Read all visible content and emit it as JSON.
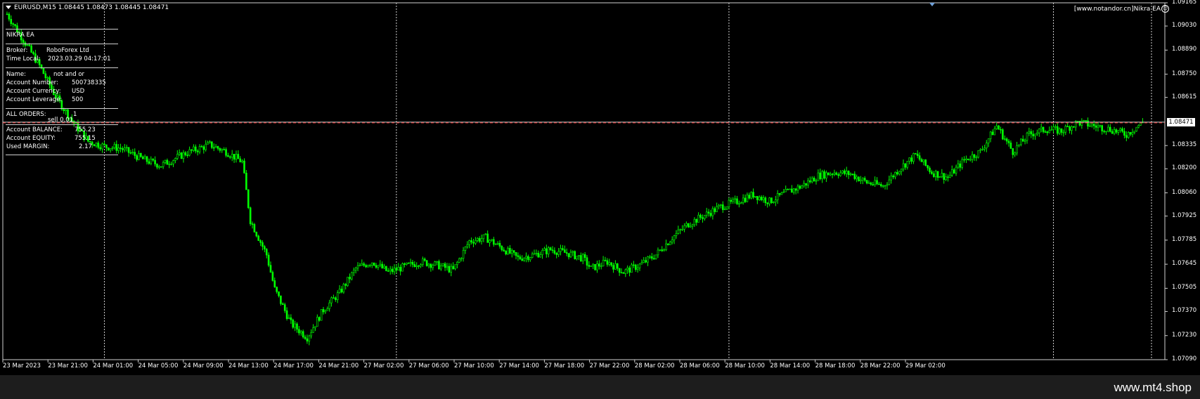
{
  "header": {
    "symbol_info": "EURUSD,M15  1.08445 1.08473 1.08445 1.08471",
    "ea_label": "[www.notandor.cn]Nikra EA"
  },
  "icons": {
    "dropdown": "triangle-down-icon",
    "smiley": "smiley-icon"
  },
  "panel": {
    "title": "NIKRA EA",
    "broker_label": "Broker:",
    "broker_value": "RoboForex Ltd",
    "time_label": "Time Local:",
    "time_value": "2023.03.29 04:17:01",
    "name_label": "Name:",
    "name_value": "not and or",
    "acct_number_label": "Account Number:",
    "acct_number_value": "500738335",
    "currency_label": "Account Currency:",
    "currency_value": "USD",
    "leverage_label": "Account Leverage:",
    "leverage_value": "500",
    "orders_label": "ALL ORDERS:",
    "orders_value": "1",
    "sell_label": "sell 0.01",
    "balance_label": "Account BALANCE:",
    "balance_value": "755.23",
    "equity_label": "Account EQUITY:",
    "equity_value": "755.15",
    "margin_label": "Used MARGIN:",
    "margin_value": "2.17"
  },
  "footer": {
    "site": "www.mt4.shop"
  },
  "chart_data": {
    "type": "candlestick",
    "symbol": "EURUSD",
    "timeframe": "M15",
    "current_price": "1.08471",
    "y_ticks": [
      "1.09165",
      "1.09030",
      "1.08890",
      "1.08750",
      "1.08615",
      "1.08335",
      "1.08200",
      "1.08060",
      "1.07925",
      "1.07785",
      "1.07645",
      "1.07505",
      "1.07370",
      "1.07230",
      "1.07090"
    ],
    "y_tick_values": [
      1.09165,
      1.0903,
      1.0889,
      1.0875,
      1.08615,
      1.08335,
      1.082,
      1.0806,
      1.07925,
      1.07785,
      1.07645,
      1.07505,
      1.0737,
      1.0723,
      1.0709
    ],
    "ylim": [
      1.0709,
      1.09165
    ],
    "x_ticks": [
      "23 Mar 2023",
      "23 Mar 21:00",
      "24 Mar 01:00",
      "24 Mar 05:00",
      "24 Mar 09:00",
      "24 Mar 13:00",
      "24 Mar 17:00",
      "24 Mar 21:00",
      "27 Mar 02:00",
      "27 Mar 06:00",
      "27 Mar 10:00",
      "27 Mar 14:00",
      "27 Mar 18:00",
      "27 Mar 22:00",
      "28 Mar 02:00",
      "28 Mar 06:00",
      "28 Mar 10:00",
      "28 Mar 14:00",
      "28 Mar 18:00",
      "28 Mar 22:00",
      "29 Mar 02:00"
    ],
    "series": [
      {
        "color": "#00ff00",
        "close_path": [
          [
            0,
            1.091
          ],
          [
            2,
            1.0895
          ],
          [
            4,
            1.088
          ],
          [
            6,
            1.0862
          ],
          [
            8,
            1.0848
          ],
          [
            10,
            1.0836
          ],
          [
            12,
            1.0833
          ],
          [
            14,
            1.0832
          ],
          [
            17,
            1.0825
          ],
          [
            19,
            1.0822
          ],
          [
            22,
            1.0829
          ],
          [
            25,
            1.0834
          ],
          [
            27,
            1.083
          ],
          [
            29,
            1.0824
          ],
          [
            30,
            1.079
          ],
          [
            32,
            1.077
          ],
          [
            33,
            1.075
          ],
          [
            35,
            1.073
          ],
          [
            37,
            1.0722
          ],
          [
            39,
            1.0738
          ],
          [
            41,
            1.0748
          ],
          [
            43,
            1.0762
          ],
          [
            45,
            1.0766
          ],
          [
            47,
            1.076
          ],
          [
            49,
            1.0763
          ],
          [
            51,
            1.0766
          ],
          [
            53,
            1.0764
          ],
          [
            55,
            1.0761
          ],
          [
            57,
            1.0778
          ],
          [
            59,
            1.078
          ],
          [
            61,
            1.0774
          ],
          [
            63,
            1.0768
          ],
          [
            65,
            1.077
          ],
          [
            67,
            1.0773
          ],
          [
            69,
            1.0771
          ],
          [
            71,
            1.0768
          ],
          [
            72,
            1.0762
          ],
          [
            74,
            1.0766
          ],
          [
            76,
            1.076
          ],
          [
            78,
            1.0764
          ],
          [
            80,
            1.077
          ],
          [
            82,
            1.078
          ],
          [
            84,
            1.0788
          ],
          [
            86,
            1.0793
          ],
          [
            88,
            1.0798
          ],
          [
            90,
            1.0801
          ],
          [
            92,
            1.0805
          ],
          [
            94,
            1.0801
          ],
          [
            96,
            1.0806
          ],
          [
            98,
            1.081
          ],
          [
            100,
            1.0816
          ],
          [
            102,
            1.0818
          ],
          [
            104,
            1.0817
          ],
          [
            106,
            1.0812
          ],
          [
            108,
            1.081
          ],
          [
            110,
            1.082
          ],
          [
            112,
            1.0828
          ],
          [
            114,
            1.0818
          ],
          [
            116,
            1.0815
          ],
          [
            118,
            1.0825
          ],
          [
            120,
            1.083
          ],
          [
            122,
            1.0845
          ],
          [
            124,
            1.083
          ],
          [
            126,
            1.084
          ],
          [
            128,
            1.0843
          ],
          [
            130,
            1.0842
          ],
          [
            132,
            1.0847
          ],
          [
            134,
            1.0845
          ],
          [
            136,
            1.0843
          ],
          [
            138,
            1.084
          ],
          [
            140,
            1.0847
          ]
        ]
      }
    ],
    "grid": false,
    "vertical_separators": [
      12,
      48,
      89,
      129,
      164
    ]
  }
}
